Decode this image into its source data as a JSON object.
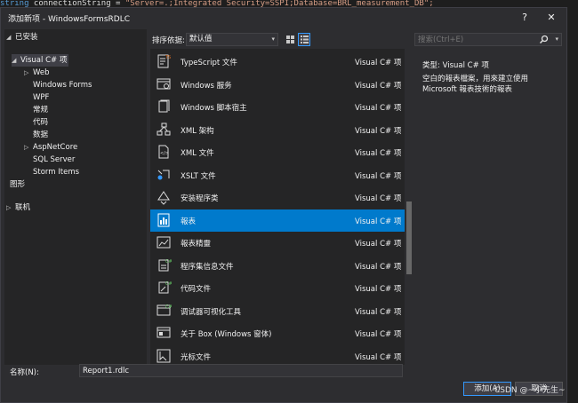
{
  "code_line": {
    "keyword": "string",
    "plain1": " connectionString = ",
    "string": "\"Server=.;Integrated Security=SSPI;Database=BRL_measurement_DB\";"
  },
  "dialog": {
    "title": "添加新项 - WindowsFormsRDLC",
    "help_label": "?",
    "close_label": "✕"
  },
  "tree": {
    "installed": "已安装",
    "visual_cs": "Visual C# 项",
    "web": "Web",
    "windows_forms": "Windows Forms",
    "wpf": "WPF",
    "general": "常规",
    "code": "代码",
    "data": "数据",
    "aspnetcore": "AspNetCore",
    "sql_server": "SQL Server",
    "storm_items": "Storm Items",
    "graphics": "图形",
    "online": "联机"
  },
  "toolbar": {
    "sort_label": "排序依据:",
    "sort_value": "默认值"
  },
  "search": {
    "placeholder": "搜索(Ctrl+E)"
  },
  "items": [
    {
      "name": "TypeScript 文件",
      "type": "Visual C# 项",
      "icon": "typescript-file-icon"
    },
    {
      "name": "Windows 服务",
      "type": "Visual C# 项",
      "icon": "windows-service-icon"
    },
    {
      "name": "Windows 脚本宿主",
      "type": "Visual C# 项",
      "icon": "script-host-icon"
    },
    {
      "name": "XML 架构",
      "type": "Visual C# 项",
      "icon": "xml-schema-icon"
    },
    {
      "name": "XML 文件",
      "type": "Visual C# 项",
      "icon": "xml-file-icon"
    },
    {
      "name": "XSLT 文件",
      "type": "Visual C# 项",
      "icon": "xslt-file-icon"
    },
    {
      "name": "安装程序类",
      "type": "Visual C# 项",
      "icon": "installer-class-icon"
    },
    {
      "name": "報表",
      "type": "Visual C# 项",
      "icon": "report-icon"
    },
    {
      "name": "報表精靈",
      "type": "Visual C# 项",
      "icon": "report-wizard-icon"
    },
    {
      "name": "程序集信息文件",
      "type": "Visual C# 项",
      "icon": "assembly-info-icon"
    },
    {
      "name": "代码文件",
      "type": "Visual C# 项",
      "icon": "code-file-icon"
    },
    {
      "name": "调试器可视化工具",
      "type": "Visual C# 项",
      "icon": "debugger-visualizer-icon"
    },
    {
      "name": "关于 Box (Windows 窗体)",
      "type": "Visual C# 项",
      "icon": "about-box-icon"
    },
    {
      "name": "光标文件",
      "type": "Visual C# 项",
      "icon": "cursor-file-icon"
    }
  ],
  "details": {
    "type_label": "类型:",
    "type_value": "Visual C# 项",
    "description": "空白的報表檔案，用來建立使用 Microsoft 報表技術的報表"
  },
  "name_field": {
    "label": "名称(N):",
    "value": "Report1.rdlc"
  },
  "buttons": {
    "add": "添加(A)",
    "cancel": "取消"
  },
  "watermark": "CSDN @~小先生~",
  "colors": {
    "accent": "#007acc",
    "background": "#2d2d30",
    "panel": "#252526"
  }
}
